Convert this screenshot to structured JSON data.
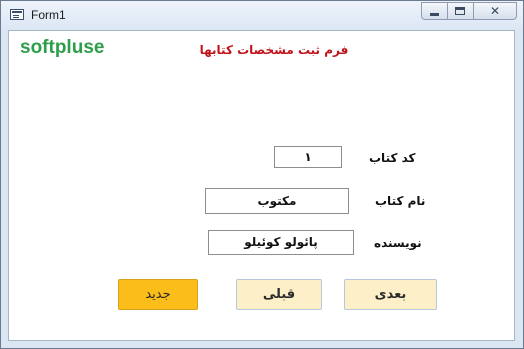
{
  "window": {
    "title": "Form1",
    "minimize_icon": "minimize-icon",
    "maximize_icon": "maximize-icon",
    "close_icon": "close-icon"
  },
  "header": {
    "brand": "softpluse",
    "form_title": "فرم ثبت مشخصات کتابها"
  },
  "fields": {
    "code": {
      "label": "کد کتاب",
      "value": "۱"
    },
    "name": {
      "label": "نام کتاب",
      "value": "مکتوب"
    },
    "author": {
      "label": "نویسنده",
      "value": "پائولو کوئیلو"
    }
  },
  "buttons": {
    "next": "بعدی",
    "previous": "قبلی",
    "new": "جدید"
  },
  "colors": {
    "brand": "#2e9e4a",
    "form_title": "#c0141b",
    "button_soft": "#fdefc7",
    "button_new": "#fbbd1a"
  }
}
